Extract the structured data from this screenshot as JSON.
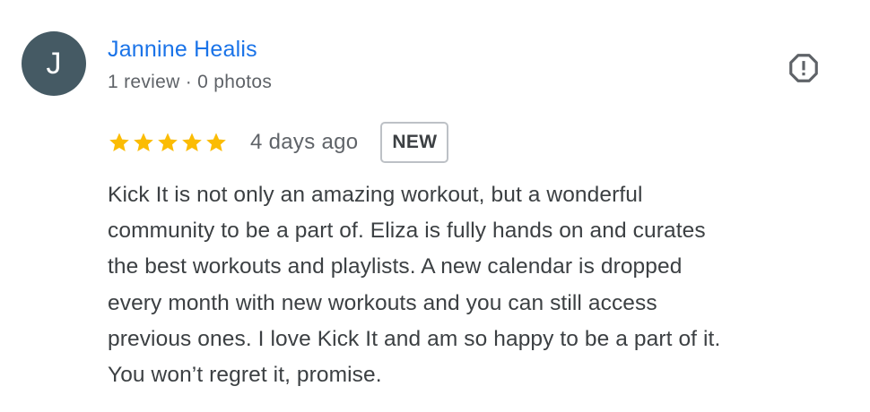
{
  "review": {
    "avatar_letter": "J",
    "avatar_color": "#455a64",
    "reviewer_name": "Jannine Healis",
    "reviewer_meta": "1 review · 0 photos",
    "flag_icon": "report-flag-icon",
    "rating": 5,
    "rating_max": 5,
    "star_color": "#fbbc04",
    "date": "4 days ago",
    "badge": "NEW",
    "text_lines": [
      "Kick It is not only an amazing workout, but a wonderful",
      "community to be a part of. Eliza is fully hands on and curates",
      "the best workouts and playlists. A new calendar is dropped",
      "every month with new workouts and you can still access",
      "previous ones. I love Kick It and am so happy to be a part of it.",
      "You won’t regret it, promise."
    ]
  }
}
